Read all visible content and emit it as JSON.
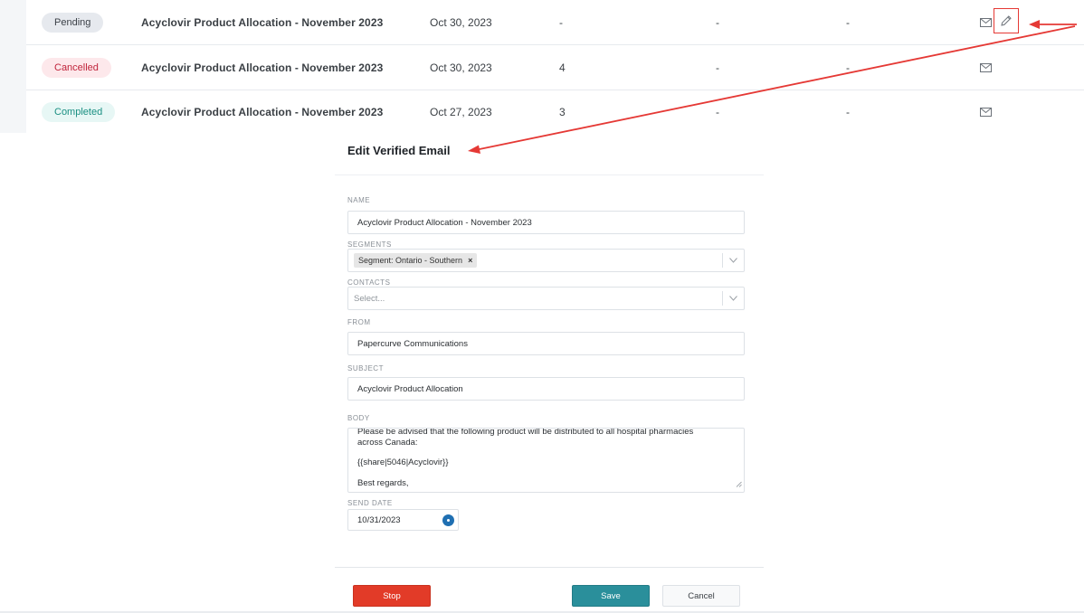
{
  "table": {
    "rows": [
      {
        "status": "Pending",
        "status_kind": "pending",
        "name": "Acyclovir Product Allocation - November 2023",
        "date": "Oct 30, 2023",
        "count": "-",
        "col_a": "-",
        "col_b": "-"
      },
      {
        "status": "Cancelled",
        "status_kind": "cancelled",
        "name": "Acyclovir Product Allocation - November 2023",
        "date": "Oct 30, 2023",
        "count": "4",
        "col_a": "-",
        "col_b": "-"
      },
      {
        "status": "Completed",
        "status_kind": "completed",
        "name": "Acyclovir Product Allocation - November 2023",
        "date": "Oct 27, 2023",
        "count": "3",
        "col_a": "-",
        "col_b": "-"
      }
    ],
    "actions": {
      "mail_icon": "mail-icon",
      "edit_icon": "pencil-icon"
    }
  },
  "modal": {
    "title": "Edit Verified Email",
    "name": {
      "label": "NAME",
      "value": "Acyclovir Product Allocation -  November 2023"
    },
    "segments": {
      "label": "SEGMENTS",
      "chip": "Segment: Ontario - Southern",
      "chip_remove": "×"
    },
    "contacts": {
      "label": "CONTACTS",
      "placeholder": "Select..."
    },
    "from": {
      "label": "FROM",
      "value": "Papercurve Communications"
    },
    "subject": {
      "label": "SUBJECT",
      "value": "Acyclovir Product Allocation"
    },
    "body": {
      "label": "BODY",
      "lines": [
        "Please be advised that the following product will be distributed to all hospital pharmacies",
        "across Canada:",
        "{{share|5046|Acyclovir}}",
        "Best regards,"
      ]
    },
    "send_date": {
      "label": "SEND DATE",
      "value": "10/31/2023"
    },
    "buttons": {
      "stop": "Stop",
      "save": "Save",
      "cancel": "Cancel"
    }
  },
  "colors": {
    "annotation_red": "#e53935",
    "stop_red": "#e23b28",
    "save_teal": "#2a8f9b",
    "date_dot_blue": "#1f6fb2"
  }
}
